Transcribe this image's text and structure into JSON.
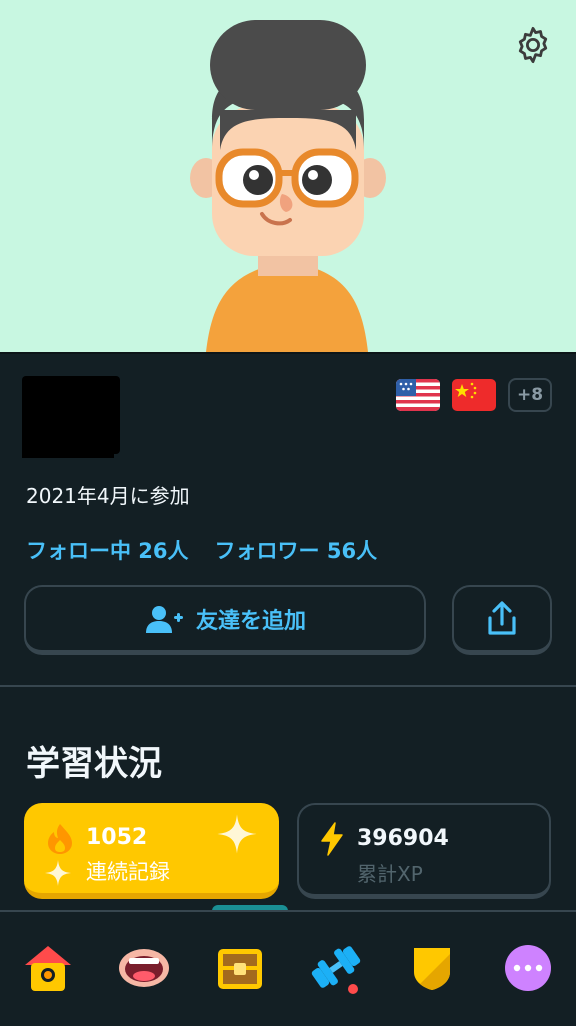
{
  "profile": {
    "joined": "2021年4月に参加",
    "following": "フォロー中 26人",
    "followers": "フォロワー 56人",
    "courses_more": "+8",
    "add_friend_label": "友達を追加"
  },
  "stats": {
    "title": "学習状況",
    "streak_value": "1052",
    "streak_label": "連続記録",
    "xp_value": "396904",
    "xp_label": "累計XP"
  },
  "icons": {
    "settings": "gear-icon",
    "share": "share-icon",
    "add_friend": "add-user-icon",
    "streak": "flame-icon",
    "xp": "lightning-icon"
  },
  "tabs": [
    "home",
    "speak",
    "treasure",
    "practice",
    "league",
    "more"
  ],
  "colors": {
    "background": "#131f24",
    "hero": "#c8f7e1",
    "accent_blue": "#49c0f8",
    "streak_yellow": "#ffc800",
    "border": "#37464f"
  }
}
